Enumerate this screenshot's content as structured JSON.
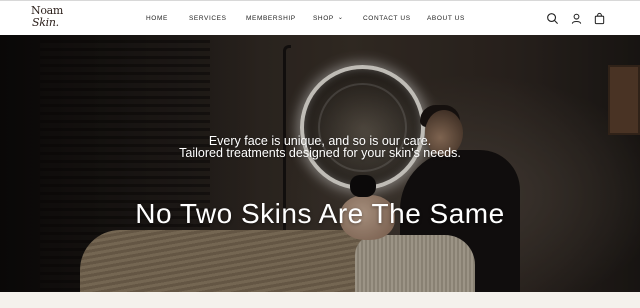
{
  "brand": {
    "logo_line1": "Noam",
    "logo_line2": "Skin."
  },
  "nav": {
    "items": [
      {
        "label": "HOME"
      },
      {
        "label": "SERVICES"
      },
      {
        "label": "MEMBERSHIP"
      },
      {
        "label": "SHOP",
        "has_dropdown": true
      },
      {
        "label": "CONTACT US"
      },
      {
        "label": "ABOUT US"
      }
    ]
  },
  "header_icons": [
    "search-icon",
    "account-icon",
    "cart-icon"
  ],
  "hero": {
    "tagline_line1": "Every face is unique, and so is our care.",
    "tagline_line2": "Tailored treatments designed for your skin's needs.",
    "title": "No Two Skins Are The Same"
  },
  "colors": {
    "header_bg": "#ffffff",
    "text_dark": "#222222",
    "hero_text": "#ffffff",
    "page_bg": "#f4f1ec"
  }
}
